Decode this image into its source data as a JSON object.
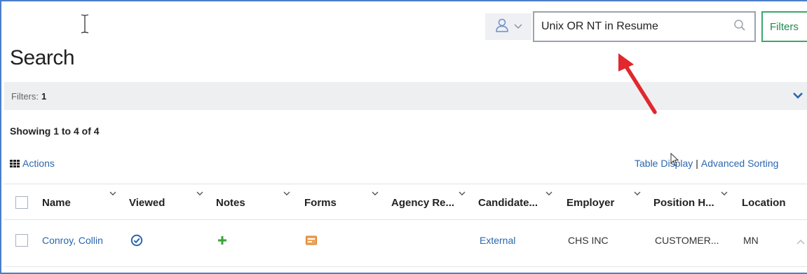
{
  "header": {
    "search_value": "Unix OR NT in Resume",
    "filters_label": "Filters"
  },
  "page": {
    "title": "Search",
    "filters_label": "Filters:",
    "filters_count": "1",
    "showing": "Showing 1 to 4 of 4",
    "actions_label": "Actions",
    "table_display_label": "Table Display",
    "separator": "|",
    "advanced_sorting_label": "Advanced Sorting"
  },
  "table": {
    "columns": [
      "Name",
      "Viewed",
      "Notes",
      "Forms",
      "Agency Re...",
      "Candidate...",
      "Employer",
      "Position H...",
      "Location"
    ],
    "rows": [
      {
        "name": "Conroy, Collin",
        "candidate_type": "External",
        "employer": "CHS INC",
        "position": "CUSTOMER...",
        "location": "MN"
      }
    ]
  },
  "colors": {
    "link": "#2b66ae",
    "accent_green": "#3aa76d",
    "annotation_arrow": "#e0282e",
    "frame": "#4a7ec7"
  },
  "icons": [
    "user-icon",
    "chevron-down-icon",
    "search-icon",
    "grid-icon",
    "check-circle-icon",
    "plus-icon",
    "form-icon",
    "sort-icon",
    "arrow-annotation-icon"
  ]
}
